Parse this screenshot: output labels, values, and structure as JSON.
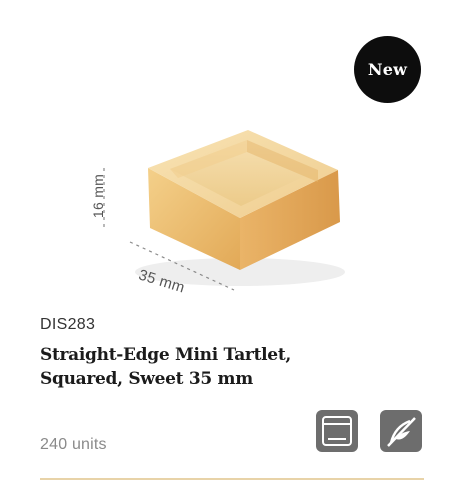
{
  "badge": {
    "label": "New"
  },
  "product": {
    "sku": "DIS283",
    "title_line1": "Straight-Edge Mini Tartlet,",
    "title_line2": "Squared, Sweet 35 mm",
    "units": "240 units",
    "image_icon": "square-tartlet-shell"
  },
  "dimensions": {
    "height_label": "16 mm",
    "width_label": "35 mm"
  },
  "icons": {
    "oven": "oven-icon",
    "no_bake": "no-baking-required-icon"
  },
  "colors": {
    "badge_bg": "#0d0d0d",
    "icon_bg": "#6d6d6d",
    "divider": "#e8d3a8",
    "pastry": "#e8b96b"
  }
}
